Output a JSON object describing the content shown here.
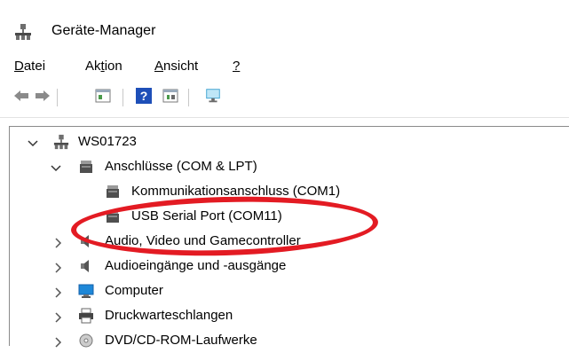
{
  "window": {
    "title": "Geräte-Manager",
    "app_icon": "device-manager-icon"
  },
  "menu": [
    {
      "label": "Datei",
      "underline_index": 0
    },
    {
      "label": "Aktion",
      "underline_index": 2
    },
    {
      "label": "Ansicht",
      "underline_index": 0
    },
    {
      "label": "?",
      "underline_index": 0
    }
  ],
  "toolbar": {
    "buttons": [
      "back-arrow-icon",
      "forward-arrow-icon",
      "properties-icon",
      "help-icon",
      "toggle-view-icon",
      "monitor-scan-icon"
    ]
  },
  "tree": {
    "root": {
      "label": "WS01723",
      "icon": "computer-network-icon",
      "expanded": true
    },
    "items": [
      {
        "label": "Anschlüsse (COM & LPT)",
        "icon": "port-icon",
        "expanded": true,
        "level": 1
      },
      {
        "label": "Kommunikationsanschluss (COM1)",
        "icon": "port-icon",
        "level": 2
      },
      {
        "label": "USB Serial Port (COM11)",
        "icon": "port-icon",
        "level": 2,
        "highlighted": true
      },
      {
        "label": "Audio, Video und Gamecontroller",
        "icon": "speaker-icon",
        "expanded": false,
        "level": 1
      },
      {
        "label": "Audioeingänge und -ausgänge",
        "icon": "speaker-icon",
        "expanded": false,
        "level": 1
      },
      {
        "label": "Computer",
        "icon": "monitor-icon",
        "expanded": false,
        "level": 1
      },
      {
        "label": "Druckwarteschlangen",
        "icon": "printer-icon",
        "expanded": false,
        "level": 1
      },
      {
        "label": "DVD/CD-ROM-Laufwerke",
        "icon": "dvd-drive-icon",
        "expanded": false,
        "level": 1
      }
    ]
  },
  "colors": {
    "highlight": "#e31b23",
    "accent": "#1e6fd9"
  }
}
